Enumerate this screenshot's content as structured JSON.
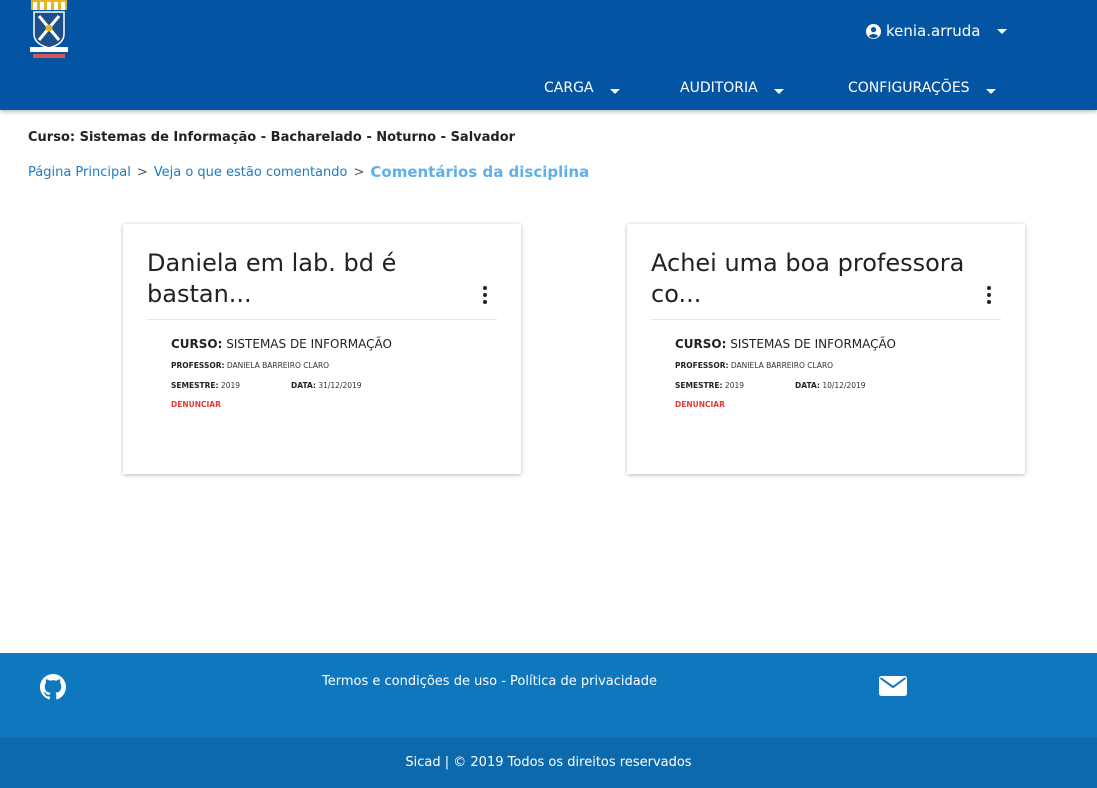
{
  "header": {
    "username": "kenia.arruda",
    "nav": [
      {
        "label": "CARGA"
      },
      {
        "label": "AUDITORIA"
      },
      {
        "label": "CONFIGURAÇÕES"
      }
    ]
  },
  "course_title": "Curso: Sistemas de Informação - Bacharelado - Noturno - Salvador",
  "breadcrumb": {
    "home": "Página Principal",
    "sep": ">",
    "comments": "Veja o que estão comentando",
    "current": "Comentários da disciplina"
  },
  "labels": {
    "curso": "CURSO:",
    "professor": "PROFESSOR:",
    "semestre": "SEMESTRE:",
    "data": "DATA:",
    "report": "DENUNCIAR"
  },
  "cards": [
    {
      "title": "Daniela em lab. bd é bastan...",
      "curso": "SISTEMAS DE INFORMAÇÃO",
      "professor": "DANIELA BARREIRO CLARO",
      "semestre": "2019",
      "data": "31/12/2019"
    },
    {
      "title": "Achei uma boa professora co...",
      "curso": "SISTEMAS DE INFORMAÇÃO",
      "professor": "DANIELA BARREIRO CLARO",
      "semestre": "2019",
      "data": "10/12/2019"
    }
  ],
  "footer": {
    "terms": "Termos e condições de uso - Política de privacidade",
    "copyright": "Sicad | © 2019 Todos os direitos reservados"
  },
  "colors": {
    "header_bg": "#0355a3",
    "footer_top_bg": "#0e77bd",
    "footer_bottom_bg": "#0c6aac",
    "link": "#1b7cc4",
    "breadcrumb_current": "#5fb0e8",
    "report": "#e53935"
  },
  "icons": {
    "logo": "ufba-crest-logo",
    "user": "account-circle-icon",
    "menu": "more-vert-icon",
    "github": "github-icon",
    "mail": "envelope-icon"
  }
}
